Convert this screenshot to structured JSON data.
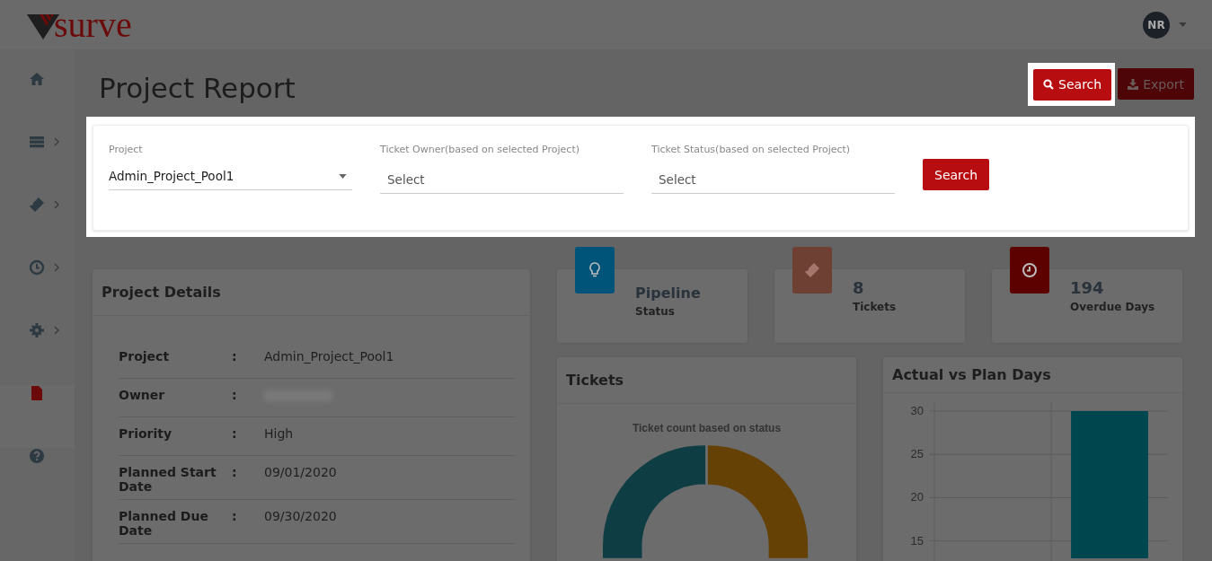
{
  "header": {
    "logo": "surve",
    "avatar": "NR"
  },
  "sidebar": {
    "items": [
      {
        "kind": "home",
        "expandable": false,
        "selected": false
      },
      {
        "kind": "list",
        "expandable": true,
        "selected": false
      },
      {
        "kind": "ticket",
        "expandable": true,
        "selected": false
      },
      {
        "kind": "clock",
        "expandable": true,
        "selected": false
      },
      {
        "kind": "gear",
        "expandable": true,
        "selected": false
      },
      {
        "kind": "report",
        "expandable": false,
        "selected": true
      },
      {
        "kind": "help",
        "expandable": false,
        "selected": false
      }
    ]
  },
  "page": {
    "title": "Project Report",
    "buttons": [
      {
        "label": "Search",
        "kind": "search",
        "highlighted": true
      },
      {
        "label": "Export",
        "kind": "export",
        "highlighted": false
      }
    ]
  },
  "filters": {
    "fields": [
      {
        "label": "Project",
        "value": "Admin_Project_Pool1",
        "kind": "dropdown"
      },
      {
        "label": "Ticket Owner(based on selected Project)",
        "placeholder": "Select",
        "kind": "text"
      },
      {
        "label": "Ticket Status(based on selected Project)",
        "placeholder": "Select",
        "kind": "text"
      }
    ],
    "button": "Search"
  },
  "project_details": {
    "title": "Project Details",
    "rows": [
      {
        "label": "Project",
        "sep": ":",
        "value": "Admin_Project_Pool1"
      },
      {
        "label": "Owner",
        "sep": ":",
        "redacted": true
      },
      {
        "label": "Priority",
        "sep": ":",
        "value": "High"
      },
      {
        "label": "Planned Start Date",
        "sep": ":",
        "value": "09/01/2020"
      },
      {
        "label": "Planned Due Date",
        "sep": ":",
        "value": "09/30/2020"
      }
    ]
  },
  "stats": [
    {
      "kind": "bulb",
      "color": "#00547a",
      "value": "Pipeline",
      "label": "Status"
    },
    {
      "kind": "ticket",
      "color": "#6e3f33",
      "value": "8",
      "label": "Tickets"
    },
    {
      "kind": "clock",
      "color": "#5c0000",
      "value": "194",
      "label": "Overdue Days"
    }
  ],
  "tickets": {
    "title": "Tickets",
    "chart_title": "Ticket count based on status"
  },
  "actual_vs_plan": {
    "title": "Actual vs Plan Days",
    "chart_data": {
      "type": "bar",
      "grid": true,
      "ylim": [
        13,
        30
      ],
      "yticks": [
        15,
        20,
        25,
        30
      ],
      "values": [
        null,
        30
      ]
    }
  }
}
